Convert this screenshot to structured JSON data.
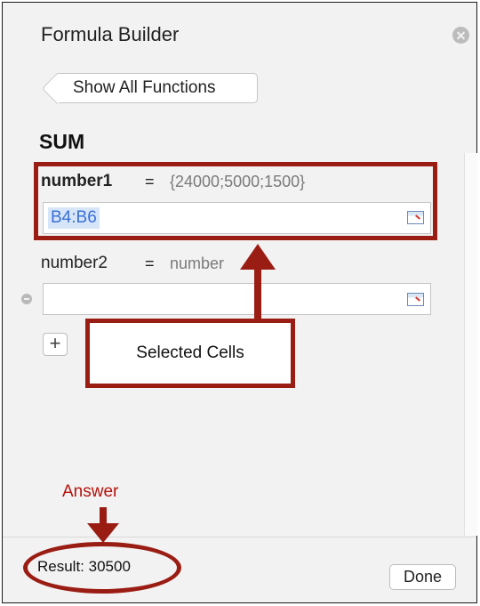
{
  "window": {
    "title": "Formula Builder",
    "show_all_label": "Show All Functions",
    "function_name": "SUM"
  },
  "arguments": [
    {
      "name": "number1",
      "equals": "=",
      "evaluated": "{24000;5000;1500}",
      "value": "B4:B6",
      "placeholder": ""
    },
    {
      "name": "number2",
      "equals": "=",
      "evaluated": "number",
      "value": "",
      "placeholder": ""
    }
  ],
  "annotations": {
    "callout_label": "Selected Cells",
    "answer_label": "Answer",
    "highlight_color": "#9a1d14",
    "answer_color": "#b5120c"
  },
  "footer": {
    "result_text": "Result: 30500",
    "done_label": "Done"
  },
  "icons": {
    "close": "close-icon",
    "remove": "minus-circle-icon",
    "add": "plus-icon",
    "cell_picker": "cell-range-picker-icon"
  }
}
